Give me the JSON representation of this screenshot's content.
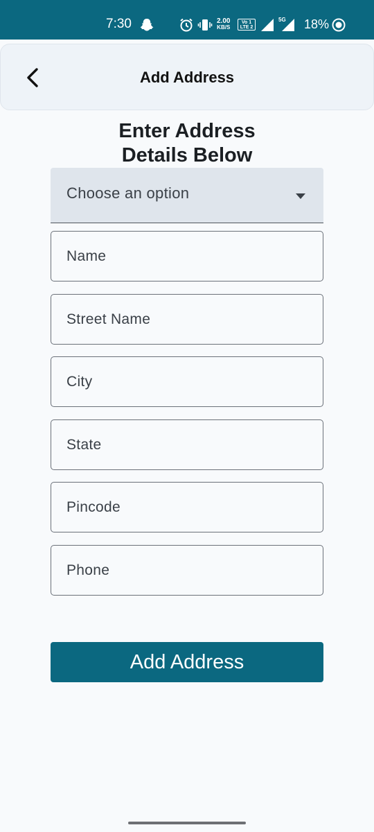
{
  "status_bar": {
    "time": "7:30",
    "speed_value": "2.00",
    "speed_unit": "KB/S",
    "lte_line1": "Vo 1",
    "lte_line2": "LTE 2",
    "network_5g": "5G",
    "battery": "18%",
    "background_color": "#0b6880"
  },
  "app_bar": {
    "title": "Add Address",
    "back_icon": "chevron-left-icon"
  },
  "form": {
    "heading_line1": "Enter Address",
    "heading_line2": "Details Below",
    "address_type": {
      "selected_label": "Choose an option",
      "icon": "dropdown-arrow-icon"
    },
    "fields": {
      "name": {
        "placeholder": "Name",
        "value": ""
      },
      "street": {
        "placeholder": "Street Name",
        "value": ""
      },
      "city": {
        "placeholder": "City",
        "value": ""
      },
      "state": {
        "placeholder": "State",
        "value": ""
      },
      "pincode": {
        "placeholder": "Pincode",
        "value": ""
      },
      "phone": {
        "placeholder": "Phone",
        "value": ""
      }
    },
    "submit_label": "Add Address",
    "accent_color": "#0b6880"
  }
}
